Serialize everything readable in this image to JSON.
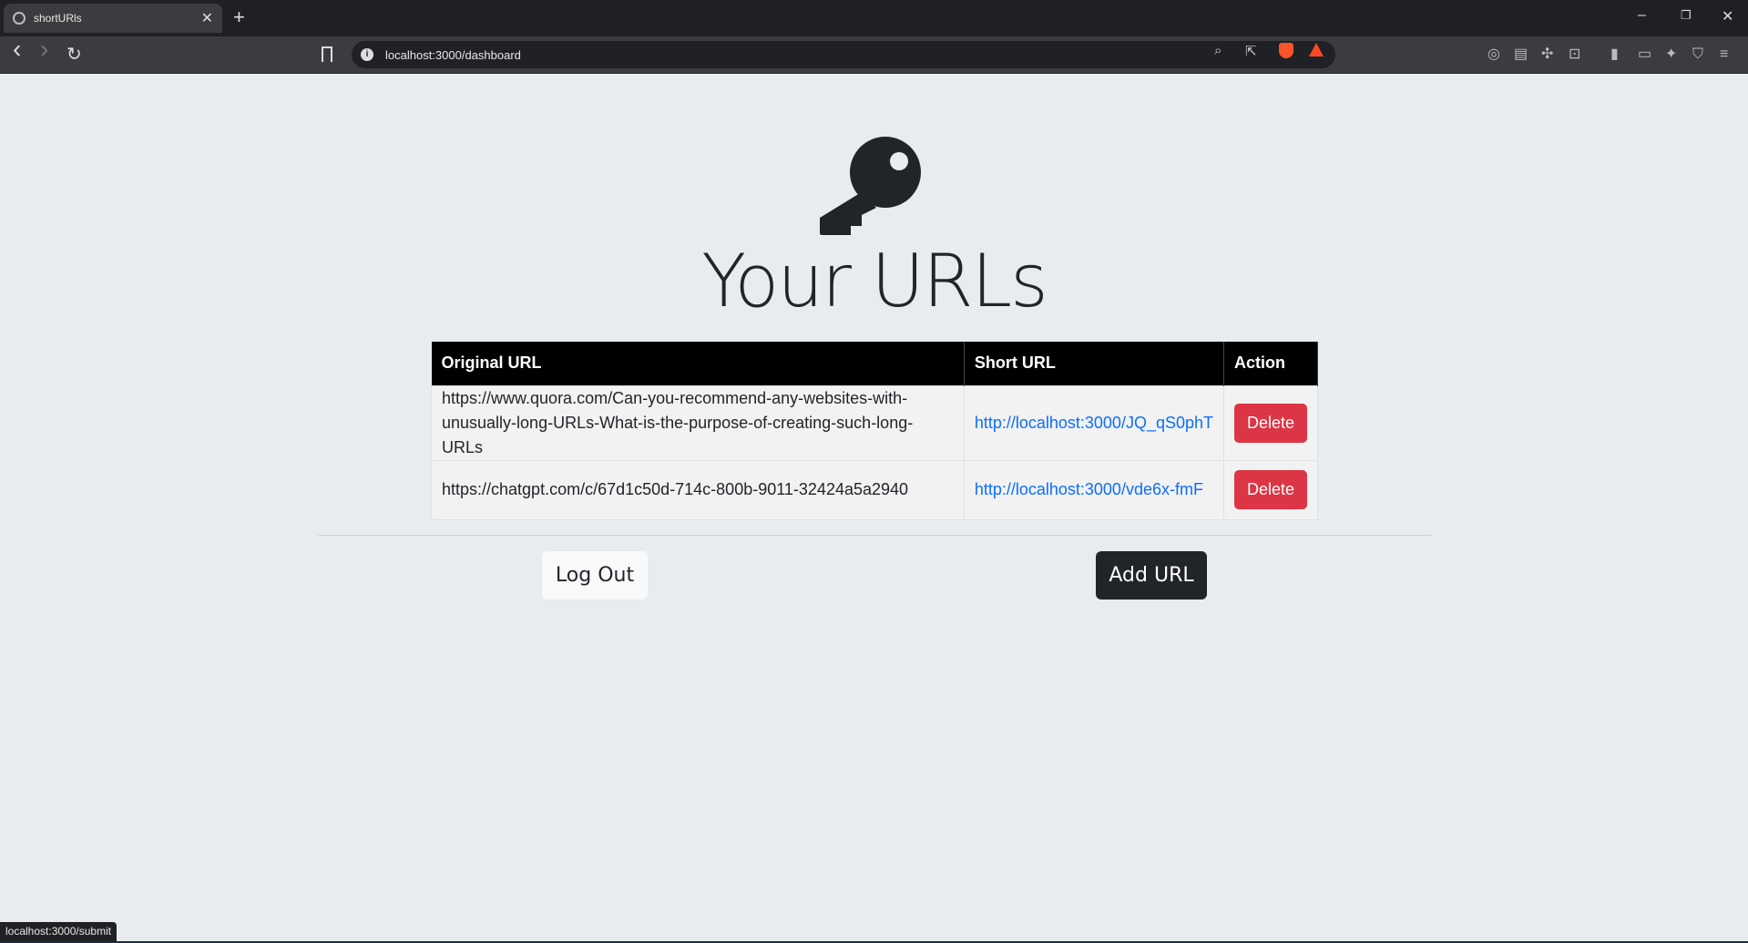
{
  "browser": {
    "tab_title": "shortURls",
    "tab_close": "✕",
    "new_tab": "+",
    "address": "localhost:3000/dashboard",
    "status_url": "localhost:3000/submit",
    "window_controls": {
      "minimize": "–",
      "restore": "❐",
      "close": "✕"
    },
    "nav": {
      "back": "‹",
      "forward": "›",
      "reload": "↻"
    },
    "brand_colors": {
      "brave": "#fb542b",
      "bat": "#ff4724"
    }
  },
  "page": {
    "icon": "key-icon",
    "title": "Your URLs",
    "table": {
      "headers": [
        "Original URL",
        "Short URL",
        "Action"
      ],
      "rows": [
        {
          "original_line1": "https://www.quora.com/Can-you-recommend-any-websites-with-",
          "original_line2": "unusually-long-URLs-What-is-the-purpose-of-creating-such-long-URLs",
          "short": "http://localhost:3000/JQ_qS0phT",
          "action": "Delete"
        },
        {
          "original_line1": "https://chatgpt.com/c/67d1c50d-714c-800b-9011-32424a5a2940",
          "original_line2": "",
          "short": "http://localhost:3000/vde6x-fmF",
          "action": "Delete"
        }
      ]
    },
    "logout_label": "Log Out",
    "add_label": "Add URL",
    "colors": {
      "delete": "#dc3545",
      "link": "#0d6efd",
      "dark": "#212529",
      "header": "#000000"
    }
  }
}
